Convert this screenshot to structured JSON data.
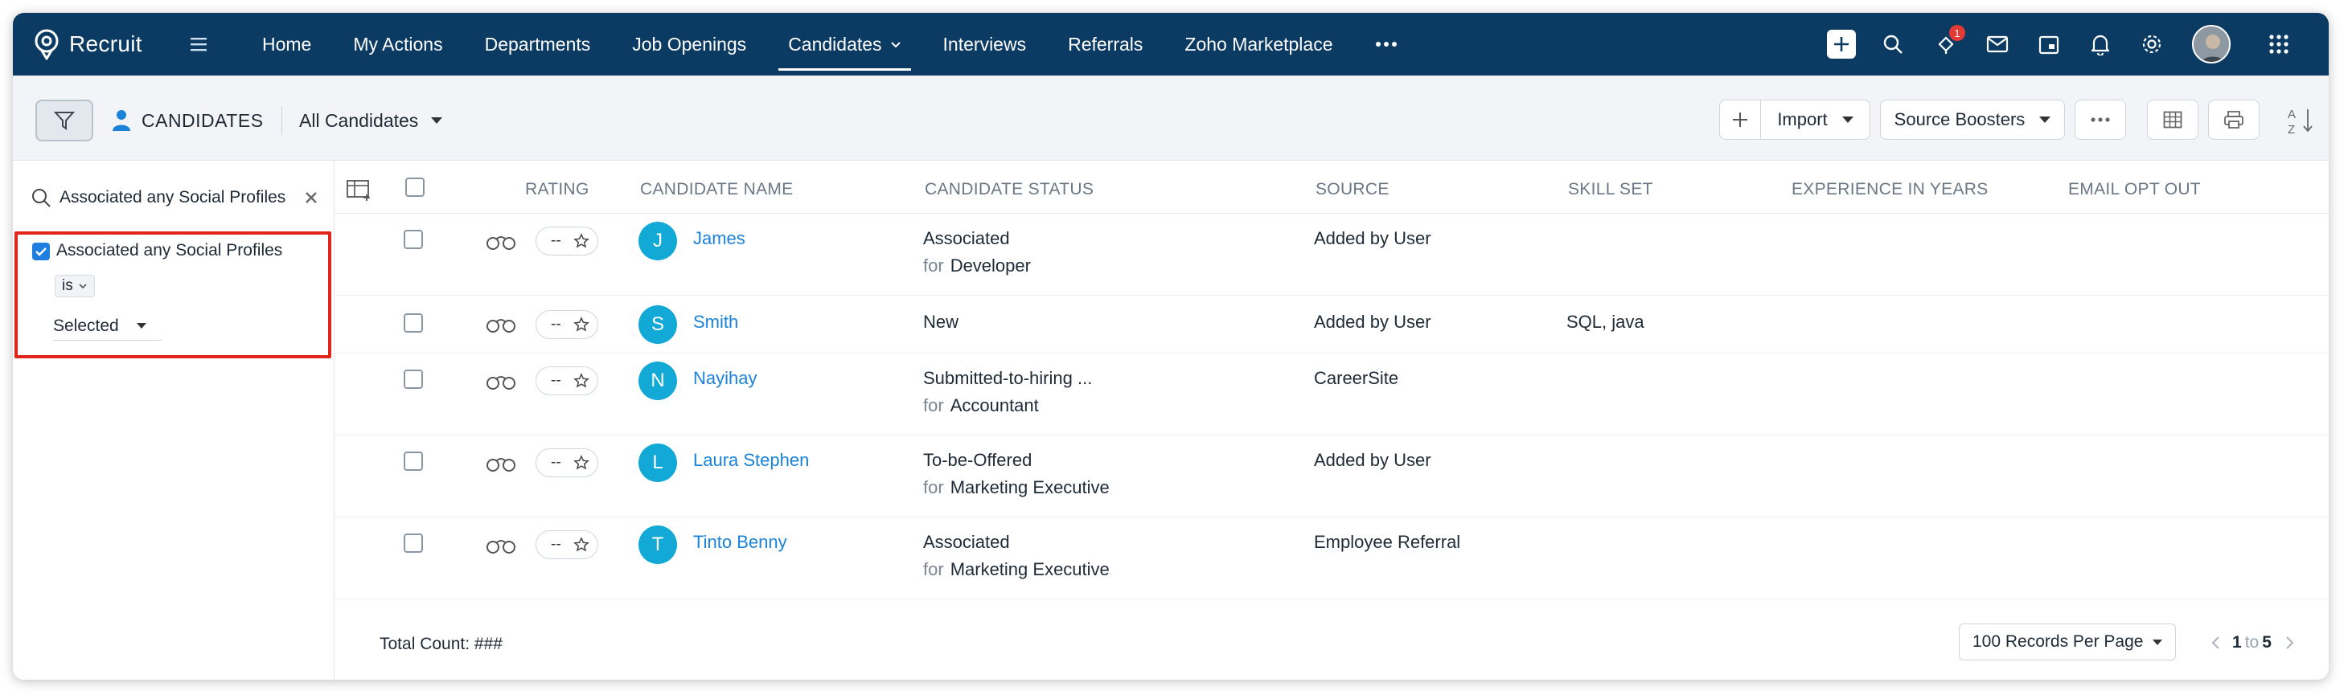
{
  "app": {
    "name": "Recruit"
  },
  "nav": {
    "items": [
      {
        "label": "Home",
        "active": false
      },
      {
        "label": "My Actions",
        "active": false
      },
      {
        "label": "Departments",
        "active": false
      },
      {
        "label": "Job Openings",
        "active": false
      },
      {
        "label": "Candidates",
        "active": true
      },
      {
        "label": "Interviews",
        "active": false
      },
      {
        "label": "Referrals",
        "active": false
      },
      {
        "label": "Zoho Marketplace",
        "active": false
      }
    ],
    "notification_count": "1"
  },
  "toolbar": {
    "page_title": "CANDIDATES",
    "view": "All Candidates",
    "import_label": "Import",
    "source_boosters_label": "Source Boosters"
  },
  "filter_panel": {
    "search_value": "Associated any Social Profiles",
    "filter_label": "Associated any Social Profiles",
    "operator": "is",
    "value": "Selected"
  },
  "table": {
    "headers": [
      "RATING",
      "CANDIDATE NAME",
      "CANDIDATE STATUS",
      "SOURCE",
      "SKILL SET",
      "EXPERIENCE IN YEARS",
      "EMAIL OPT OUT"
    ],
    "rows": [
      {
        "initial": "J",
        "name": "James",
        "status": "Associated",
        "for_prefix": "for",
        "for": "Developer",
        "source": "Added by User",
        "skills": "",
        "rating": "--"
      },
      {
        "initial": "S",
        "name": "Smith",
        "status": "New",
        "for_prefix": "",
        "for": "",
        "source": "Added by User",
        "skills": "SQL, java",
        "rating": "--"
      },
      {
        "initial": "N",
        "name": "Nayihay",
        "status": "Submitted-to-hiring ...",
        "for_prefix": "for",
        "for": "Accountant",
        "source": "CareerSite",
        "skills": "",
        "rating": "--"
      },
      {
        "initial": "L",
        "name": "Laura Stephen",
        "status": "To-be-Offered",
        "for_prefix": "for",
        "for": "Marketing Executive",
        "source": "Added by User",
        "skills": "",
        "rating": "--"
      },
      {
        "initial": "T",
        "name": "Tinto Benny",
        "status": "Associated",
        "for_prefix": "for",
        "for": "Marketing Executive",
        "source": "Employee Referral",
        "skills": "",
        "rating": "--"
      }
    ]
  },
  "footer": {
    "total_count": "Total Count: ###",
    "per_page": "100 Records Per Page",
    "page_from": "1",
    "page_to_word": "to",
    "page_to": "5"
  },
  "colors": {
    "nav_bg": "#0b3a63",
    "accent": "#1a82d9",
    "avatar_bg": "#12a9d6",
    "highlight": "#e0261b"
  },
  "icons": [
    "logo-icon",
    "menu-icon",
    "chevron-down-icon",
    "more-icon",
    "add-icon",
    "search-icon",
    "notification-icon",
    "mail-icon",
    "calendar-icon",
    "bell-icon",
    "gear-icon",
    "apps-grid-icon",
    "filter-icon",
    "person-icon",
    "plus-icon",
    "table-view-icon",
    "print-icon",
    "sort-icon",
    "column-settings-icon",
    "binoculars-icon",
    "star-icon",
    "prev-icon",
    "next-icon"
  ]
}
